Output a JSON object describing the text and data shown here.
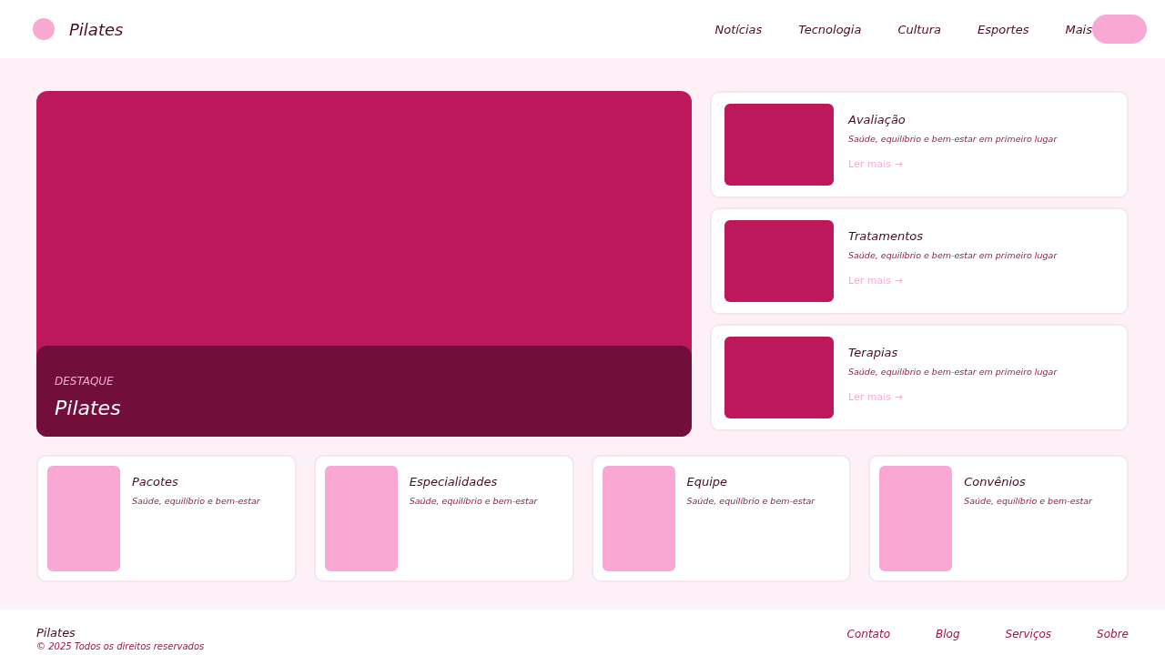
{
  "header": {
    "brand": "Pilates",
    "nav": [
      "Notícias",
      "Tecnologia",
      "Cultura",
      "Esportes",
      "Mais"
    ]
  },
  "hero": {
    "eyebrow": "DESTAQUE",
    "title": "Pilates"
  },
  "side_articles": [
    {
      "title": "Avaliação",
      "summary": "Saúde, equilíbrio e bem-estar em primeiro lugar",
      "link": "Ler mais →"
    },
    {
      "title": "Tratamentos",
      "summary": "Saúde, equilíbrio e bem-estar em primeiro lugar",
      "link": "Ler mais →"
    },
    {
      "title": "Terapias",
      "summary": "Saúde, equilíbrio e bem-estar em primeiro lugar",
      "link": "Ler mais →"
    }
  ],
  "cards": [
    {
      "title": "Pacotes",
      "summary": "Saúde, equilíbrio e bem-estar"
    },
    {
      "title": "Especialidades",
      "summary": "Saúde, equilíbrio e bem-estar"
    },
    {
      "title": "Equipe",
      "summary": "Saúde, equilíbrio e bem-estar"
    },
    {
      "title": "Convênios",
      "summary": "Saúde, equilíbrio e bem-estar"
    }
  ],
  "footer": {
    "brand": "Pilates",
    "copyright": "© 2025 Todos os direitos reservados",
    "links": [
      "Contato",
      "Blog",
      "Serviços",
      "Sobre"
    ]
  }
}
